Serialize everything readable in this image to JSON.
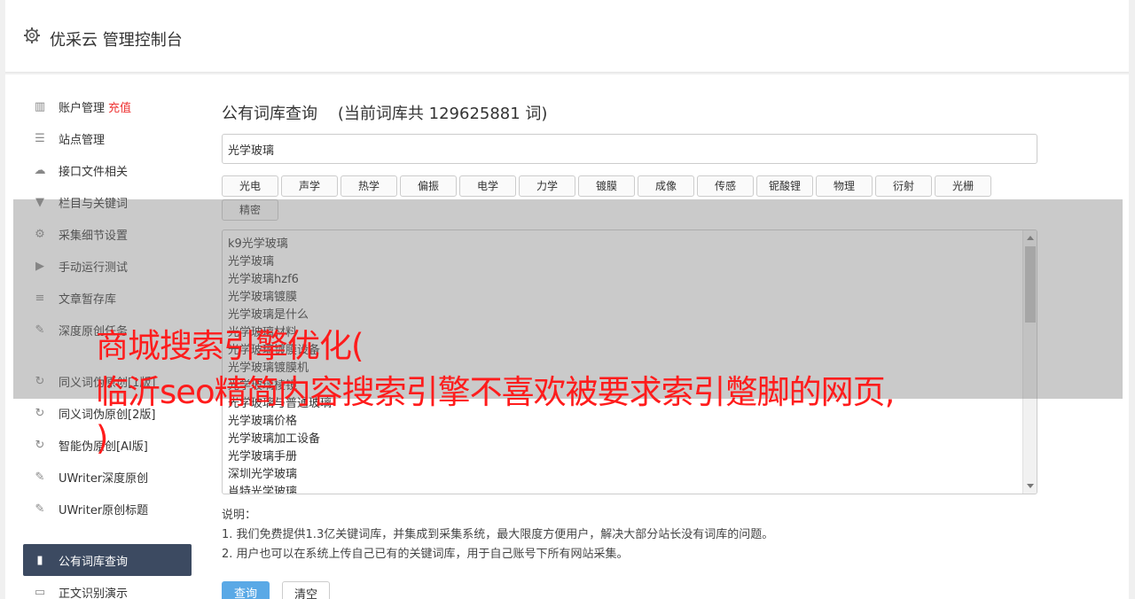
{
  "header": {
    "title": "优采云 管理控制台",
    "icon": "gear-icon"
  },
  "sidebar": {
    "group1": [
      {
        "label": "账户管理",
        "badge": "充值",
        "icon": "bar-chart-icon",
        "glyph": "▥"
      },
      {
        "label": "站点管理",
        "icon": "server-icon",
        "glyph": "☰"
      },
      {
        "label": "接口文件相关",
        "icon": "cloud-upload-icon",
        "glyph": "☁"
      },
      {
        "label": "栏目与关键词",
        "icon": "filter-icon",
        "glyph": "▼"
      },
      {
        "label": "采集细节设置",
        "icon": "gears-icon",
        "glyph": "⚙"
      },
      {
        "label": "手动运行测试",
        "icon": "play-circle-icon",
        "glyph": "▶"
      },
      {
        "label": "文章暂存库",
        "icon": "database-icon",
        "glyph": "≡"
      },
      {
        "label": "深度原创任务",
        "icon": "edit-icon",
        "glyph": "✎"
      }
    ],
    "group2": [
      {
        "label": "同义词伪原创[1版]",
        "icon": "refresh-icon",
        "glyph": "↻"
      },
      {
        "label": "同义词伪原创[2版]",
        "icon": "refresh-icon",
        "glyph": "↻"
      },
      {
        "label": "智能伪原创[AI版]",
        "icon": "refresh-icon",
        "glyph": "↻"
      },
      {
        "label": "UWriter深度原创",
        "icon": "edit-icon",
        "glyph": "✎"
      },
      {
        "label": "UWriter原创标题",
        "icon": "edit-icon",
        "glyph": "✎"
      }
    ],
    "group3": [
      {
        "label": "公有词库查询",
        "icon": "book-icon",
        "glyph": "▮",
        "active": true
      },
      {
        "label": "正文识别演示",
        "icon": "monitor-icon",
        "glyph": "▭"
      }
    ]
  },
  "main": {
    "title": "公有词库查询    (当前词库共 129625881 词)",
    "search_value": "光学玻璃",
    "tags": [
      "光电",
      "声学",
      "热学",
      "偏振",
      "电学",
      "力学",
      "镀膜",
      "成像",
      "传感",
      "铌酸锂",
      "物理",
      "衍射",
      "光栅",
      "精密"
    ],
    "results": [
      "k9光学玻璃",
      "光学玻璃",
      "光学玻璃hzf6",
      "光学玻璃镀膜",
      "光学玻璃是什么",
      "光学玻璃材料",
      "光学玻璃镀膜设备",
      "光学玻璃镀膜机",
      "光学玻璃棱镜",
      "光学玻璃与普通玻璃",
      "光学玻璃价格",
      "光学玻璃加工设备",
      "光学玻璃手册",
      "深圳光学玻璃",
      "肖特光学玻璃"
    ],
    "note_title": "说明：",
    "note_lines": [
      "1. 我们免费提供1.3亿关键词库，并集成到采集系统，最大限度方便用户，解决大部分站长没有词库的问题。",
      "2. 用户也可以在系统上传自己已有的关键词库，用于自己账号下所有网站采集。"
    ],
    "query_button": "查询",
    "clear_button": "清空"
  },
  "overlay": {
    "text": "商城搜索引擎优化(\n临沂seo精简内容搜索引擎不喜欢被要求索引蹩脚的网页,\n)",
    "color": "#ff1c1c"
  }
}
